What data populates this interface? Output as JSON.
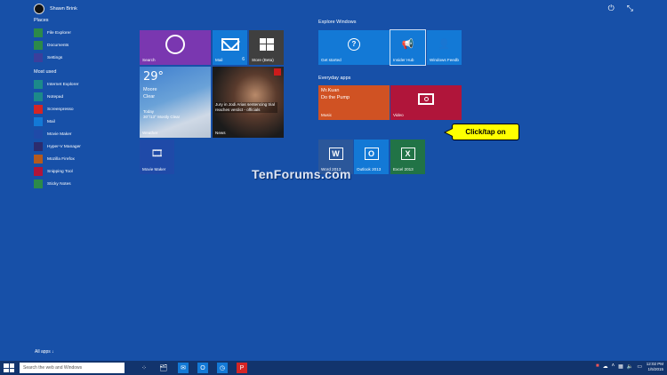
{
  "user": {
    "name": "Shawn Brink"
  },
  "colors": {
    "desktop": "#1750a8",
    "tile_purple": "#7a37b0",
    "tile_blue": "#1379d6",
    "tile_gray": "#3f3f3f",
    "tile_orange": "#d05223",
    "tile_crimson": "#b0153a",
    "word": "#2b579a",
    "excel": "#217346",
    "callout": "#ffff00"
  },
  "places": {
    "heading": "Places",
    "items": [
      {
        "label": "File Explorer",
        "icon": "folder-icon",
        "color": "#2c8a4a"
      },
      {
        "label": "Documents",
        "icon": "document-icon",
        "color": "#2c8a4a"
      },
      {
        "label": "Settings",
        "icon": "gear-icon",
        "color": "#3b3f9c"
      }
    ]
  },
  "most_used": {
    "heading": "Most used",
    "items": [
      {
        "label": "Internet Explorer",
        "icon": "ie-icon",
        "color": "#1c8a8a"
      },
      {
        "label": "Notepad",
        "icon": "notepad-icon",
        "color": "#1c8a8a"
      },
      {
        "label": "Screenpresso",
        "icon": "screenpresso-icon",
        "color": "#d42525"
      },
      {
        "label": "Mail",
        "icon": "mail-icon",
        "color": "#1379d6"
      },
      {
        "label": "Movie Maker",
        "icon": "movie-maker-icon",
        "color": "#1f4aa8"
      },
      {
        "label": "Hyper-V Manager",
        "icon": "hyperv-icon",
        "color": "#2c2c6e"
      },
      {
        "label": "Mozilla Firefox",
        "icon": "firefox-icon",
        "color": "#b65a1c"
      },
      {
        "label": "Snipping Tool",
        "icon": "scissors-icon",
        "color": "#b0153a"
      },
      {
        "label": "Sticky Notes",
        "icon": "sticky-notes-icon",
        "color": "#2c8a4a"
      }
    ]
  },
  "all_apps": "All apps ↓",
  "tiles_left": {
    "search": "Search",
    "mail": "Mail",
    "mail_count": "6",
    "store": "Store (Beta)",
    "weather": {
      "temp": "29°",
      "city": "Moore",
      "condition": "Clear",
      "today": "Today",
      "forecast": "30°/13° Mostly Clear",
      "label": "Weather"
    },
    "news": {
      "headline": "Jury in Jodi Arias sentencing trial reaches verdict - officials",
      "label": "News"
    },
    "movie_maker": "Movie Maker"
  },
  "explore": {
    "heading": "Explore Windows",
    "get_started": "Get started",
    "insider_hub": "Insider Hub",
    "windows_feedback": "Windows Feedb"
  },
  "everyday": {
    "heading": "Everyday apps",
    "music_artist": "Mr.Kuan",
    "music_song": "Do the Pump",
    "music": "Music",
    "video": "Video"
  },
  "office": {
    "word": "Word 2013",
    "outlook": "Outlook 2013",
    "excel": "Excel 2013"
  },
  "watermark": "TenForums.com",
  "callout": "Click/tap on",
  "taskbar": {
    "search_placeholder": "Search the web and Windows",
    "time": "12:02 PM",
    "date": "1/5/2015"
  }
}
